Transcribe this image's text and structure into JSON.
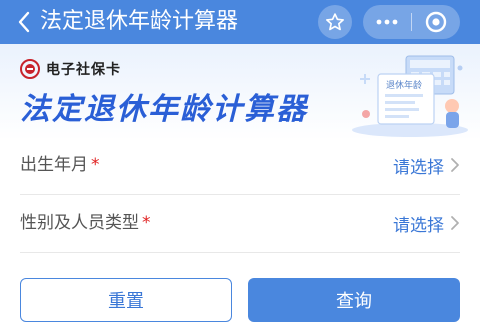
{
  "nav": {
    "title": "法定退休年龄计算器",
    "back_icon": "chevron-left-icon",
    "favorite_icon": "star-icon",
    "more_icon": "more-dots-icon",
    "close_icon": "mini-program-close-icon"
  },
  "banner": {
    "brand_text": "电子社保卡",
    "title": "法定退休年龄计算器",
    "illustration_text": "退休年龄"
  },
  "form": {
    "rows": [
      {
        "label": "出生年月",
        "required": "*",
        "value": "请选择"
      },
      {
        "label": "性别及人员类型",
        "required": "*",
        "value": "请选择"
      }
    ]
  },
  "buttons": {
    "reset": "重置",
    "query": "查询"
  },
  "colors": {
    "nav_bg": "#4a87de",
    "accent_text": "#3a77d6",
    "title_blue": "#2a5fd6",
    "required_red": "#e02020"
  }
}
